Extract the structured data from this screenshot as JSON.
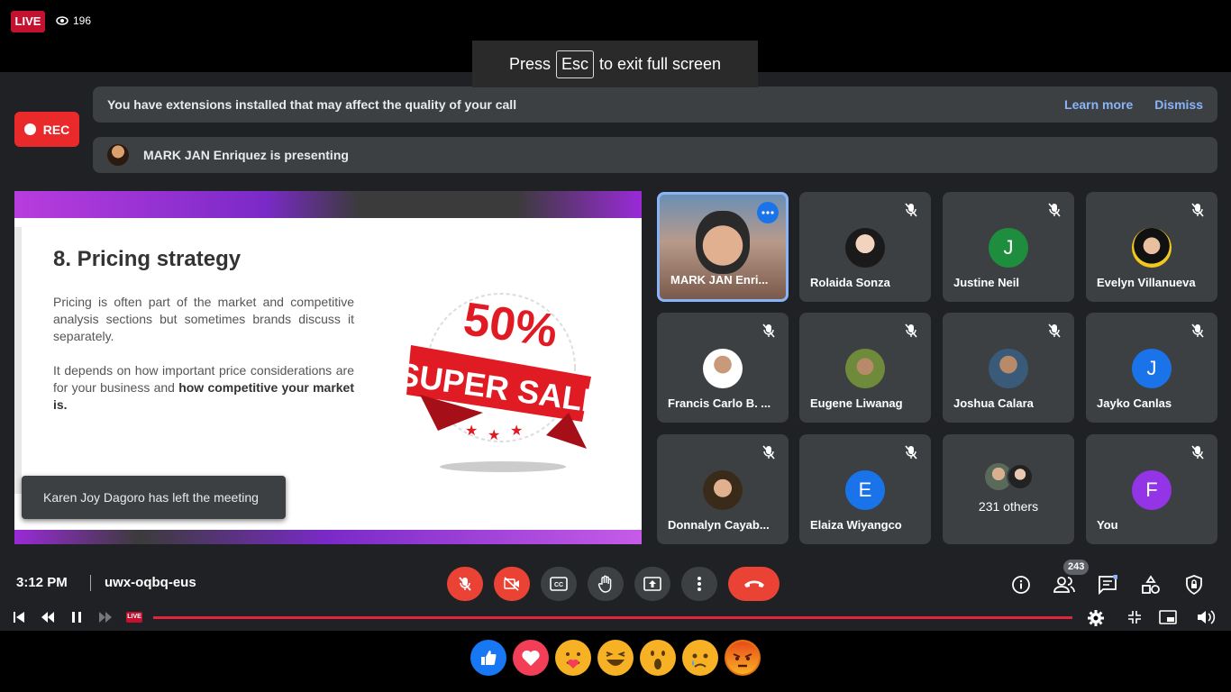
{
  "stream": {
    "live_label": "LIVE",
    "viewer_count": "196"
  },
  "fullscreen_hint": {
    "prefix": "Press",
    "key": "Esc",
    "suffix": "to exit full screen"
  },
  "meet": {
    "rec_label": "REC",
    "extensions_banner": {
      "text": "You have extensions installed that may affect the quality of your call",
      "learn_more": "Learn more",
      "dismiss": "Dismiss"
    },
    "presenting_banner": "MARK JAN Enriquez is presenting",
    "slide": {
      "title": "8.  Pricing strategy",
      "para1": "Pricing is often part of the market and competitive analysis sections but sometimes brands discuss it separately.",
      "para2_start": "It depends on how important price considerations are for your business and ",
      "para2_bold": "how competitive your market is.",
      "sale_big": "50%",
      "sale_text": "SUPER SALE"
    },
    "toast": "Karen Joy Dagoro has left the meeting",
    "participants": [
      {
        "name": "MARK JAN Enri...",
        "initial": ""
      },
      {
        "name": "Rolaida Sonza",
        "initial": ""
      },
      {
        "name": "Justine Neil",
        "initial": "J"
      },
      {
        "name": "Evelyn Villanueva",
        "initial": ""
      },
      {
        "name": "Francis Carlo B. ...",
        "initial": ""
      },
      {
        "name": "Eugene Liwanag",
        "initial": ""
      },
      {
        "name": "Joshua Calara",
        "initial": ""
      },
      {
        "name": "Jayko Canlas",
        "initial": "J"
      },
      {
        "name": "Donnalyn Cayab...",
        "initial": ""
      },
      {
        "name": "Elaiza Wiyangco",
        "initial": "E"
      },
      {
        "name": "231 others",
        "initial": ""
      },
      {
        "name": "You",
        "initial": "F"
      }
    ],
    "clock": "3:12 PM",
    "meeting_code": "uwx-oqbq-eus",
    "people_count": "243"
  },
  "player": {
    "live_label": "LIVE"
  },
  "colors": {
    "accent_red": "#ea4335",
    "meet_bg": "#202124",
    "tile_bg": "#3c4043",
    "link_blue": "#8ab4f8",
    "live_red": "#c4112f"
  }
}
